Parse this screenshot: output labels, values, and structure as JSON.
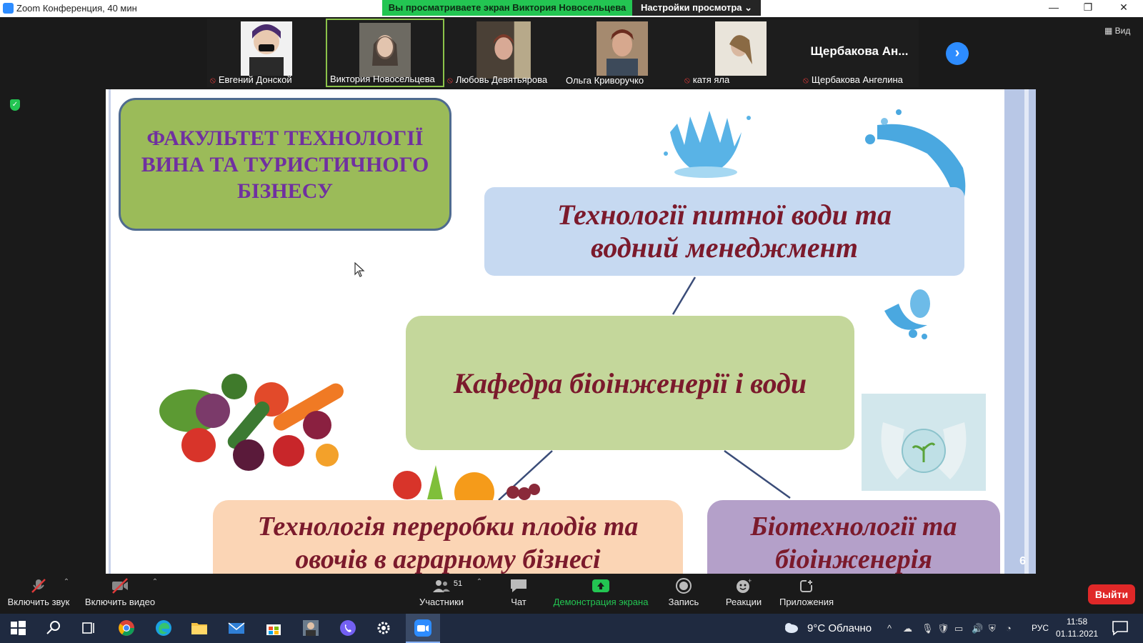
{
  "window": {
    "title": "Zoom Конференция, 40 мин",
    "viewing_banner": "Вы просматриваете экран Виктория Новосельцева",
    "view_options": "Настройки просмотра ⌄",
    "view_button": "Вид"
  },
  "participants": [
    {
      "name": "Евгений Донской",
      "muted": true
    },
    {
      "name": "Виктория Новосельцева",
      "muted": false,
      "active": true
    },
    {
      "name": "Любовь Девятьярова",
      "muted": true
    },
    {
      "name": "Ольга Криворучко",
      "muted": false
    },
    {
      "name": "катя яла",
      "muted": true
    },
    {
      "name": "Щербакова Ангелина",
      "muted": true,
      "big_label": "Щербакова Ан..."
    }
  ],
  "slide": {
    "faculty": "ФАКУЛЬТЕТ ТЕХНОЛОГІЇ ВИНА ТА ТУРИСТИЧНОГО БІЗНЕСУ",
    "water_tech": "Технології питної води та водний менеджмент",
    "department": "Кафедра біоінженерії і води",
    "fruit_tech": "Технологія переробки плодів та овочів в аграрному бізнесі",
    "biotech": "Біотехнології та біоінженерія",
    "page_number": "6"
  },
  "toolbar": {
    "unmute": "Включить звук",
    "start_video": "Включить видео",
    "participants": "Участники",
    "participants_count": "51",
    "chat": "Чат",
    "share_screen": "Демонстрация экрана",
    "record": "Запись",
    "reactions": "Реакции",
    "apps": "Приложения",
    "leave": "Выйти"
  },
  "taskbar": {
    "weather": "9°C  Облачно",
    "language": "РУС",
    "time": "11:58",
    "date": "01.11.2021"
  },
  "colors": {
    "active_tile_border": "#8bc34a",
    "banner_green": "#23c552",
    "accent_blue": "#2d8cff",
    "leave_red": "#e02828"
  }
}
